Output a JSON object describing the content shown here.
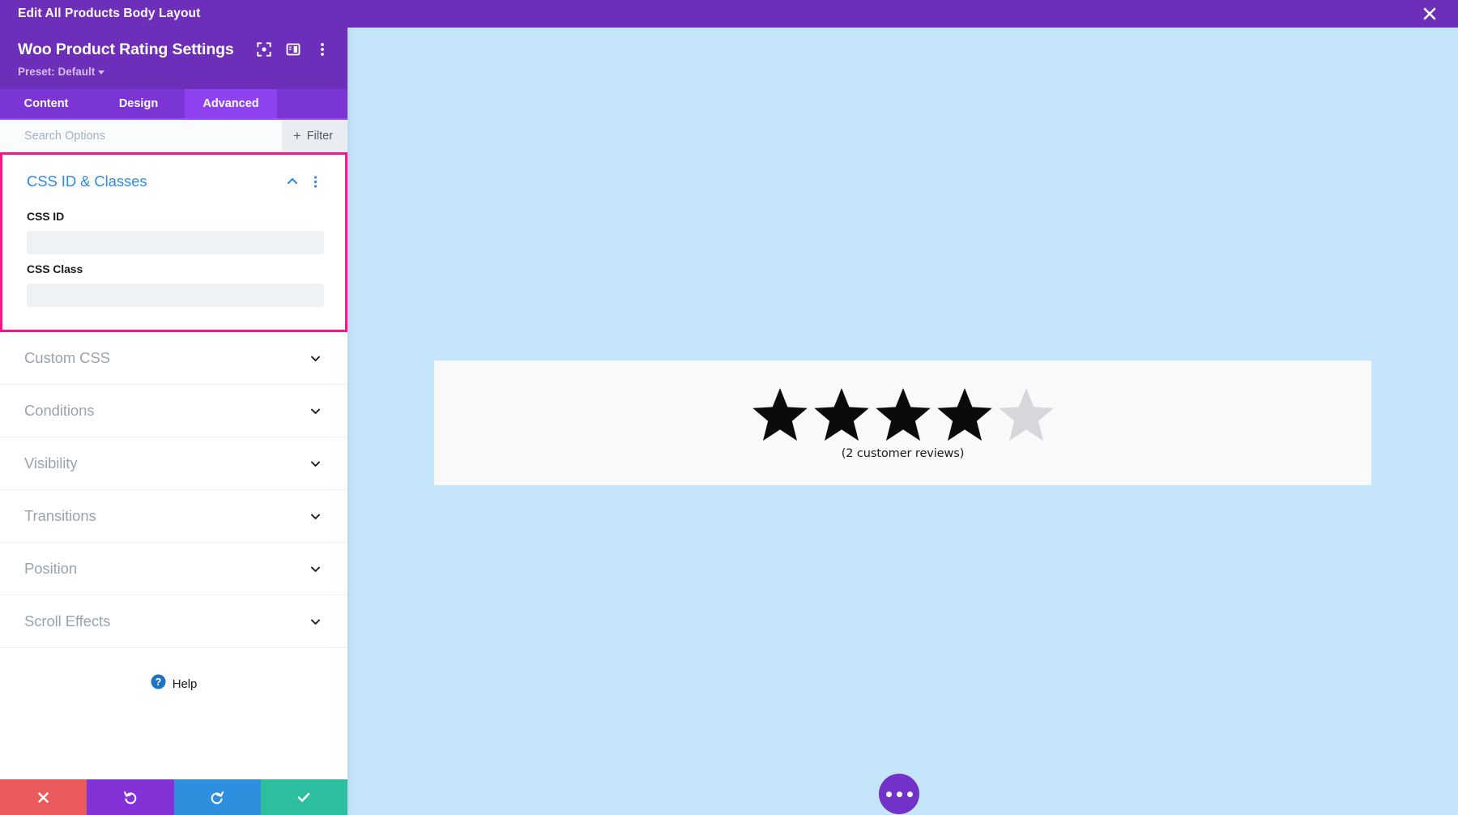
{
  "topbar": {
    "title": "Edit All Products Body Layout",
    "close_icon": "close-icon"
  },
  "panel": {
    "header": {
      "module_title": "Woo Product Rating Settings",
      "preset_label": "Preset: Default",
      "icons": [
        {
          "name": "focus-target-icon"
        },
        {
          "name": "panel-layout-icon"
        },
        {
          "name": "more-vertical-icon"
        }
      ]
    },
    "tabs": [
      {
        "label": "Content",
        "active": false
      },
      {
        "label": "Design",
        "active": false
      },
      {
        "label": "Advanced",
        "active": true
      }
    ],
    "search": {
      "placeholder": "Search Options",
      "value": "",
      "filter_label": "Filter",
      "filter_plus": "+"
    },
    "open_section": {
      "title": "CSS ID & Classes",
      "collapse_icon": "chevron-up-icon",
      "menu_icon": "more-vertical-icon",
      "highlight_color": "#f8148c",
      "title_color": "#2e8ae6",
      "fields": [
        {
          "label": "CSS ID",
          "value": "",
          "placeholder": ""
        },
        {
          "label": "CSS Class",
          "value": "",
          "placeholder": ""
        }
      ]
    },
    "sections": [
      {
        "label": "Custom CSS",
        "chevron": "chevron-down-icon"
      },
      {
        "label": "Conditions",
        "chevron": "chevron-down-icon"
      },
      {
        "label": "Visibility",
        "chevron": "chevron-down-icon"
      },
      {
        "label": "Transitions",
        "chevron": "chevron-down-icon"
      },
      {
        "label": "Position",
        "chevron": "chevron-down-icon"
      },
      {
        "label": "Scroll Effects",
        "chevron": "chevron-down-icon"
      }
    ],
    "help": {
      "label": "Help",
      "icon": "question-circle-icon"
    },
    "footer": [
      {
        "name": "discard-button",
        "icon": "close-icon",
        "color": "#eb5a5a"
      },
      {
        "name": "undo-button",
        "icon": "undo-icon",
        "color": "#8232d6"
      },
      {
        "name": "redo-button",
        "icon": "redo-icon",
        "color": "#2d8fdd"
      },
      {
        "name": "save-button",
        "icon": "checkmark-icon",
        "color": "#2bbfa0"
      }
    ]
  },
  "canvas": {
    "background_color": "#c5e5fb",
    "card_background": "#f9f9f9",
    "rating": {
      "filled": 4,
      "total": 5,
      "filled_color": "#0a0b0d",
      "empty_color": "#d5d7db",
      "review_text": "(2 customer reviews)"
    },
    "fab": {
      "name": "more-options-fab",
      "color": "#7231c9",
      "icon": "three-dots-icon"
    }
  }
}
